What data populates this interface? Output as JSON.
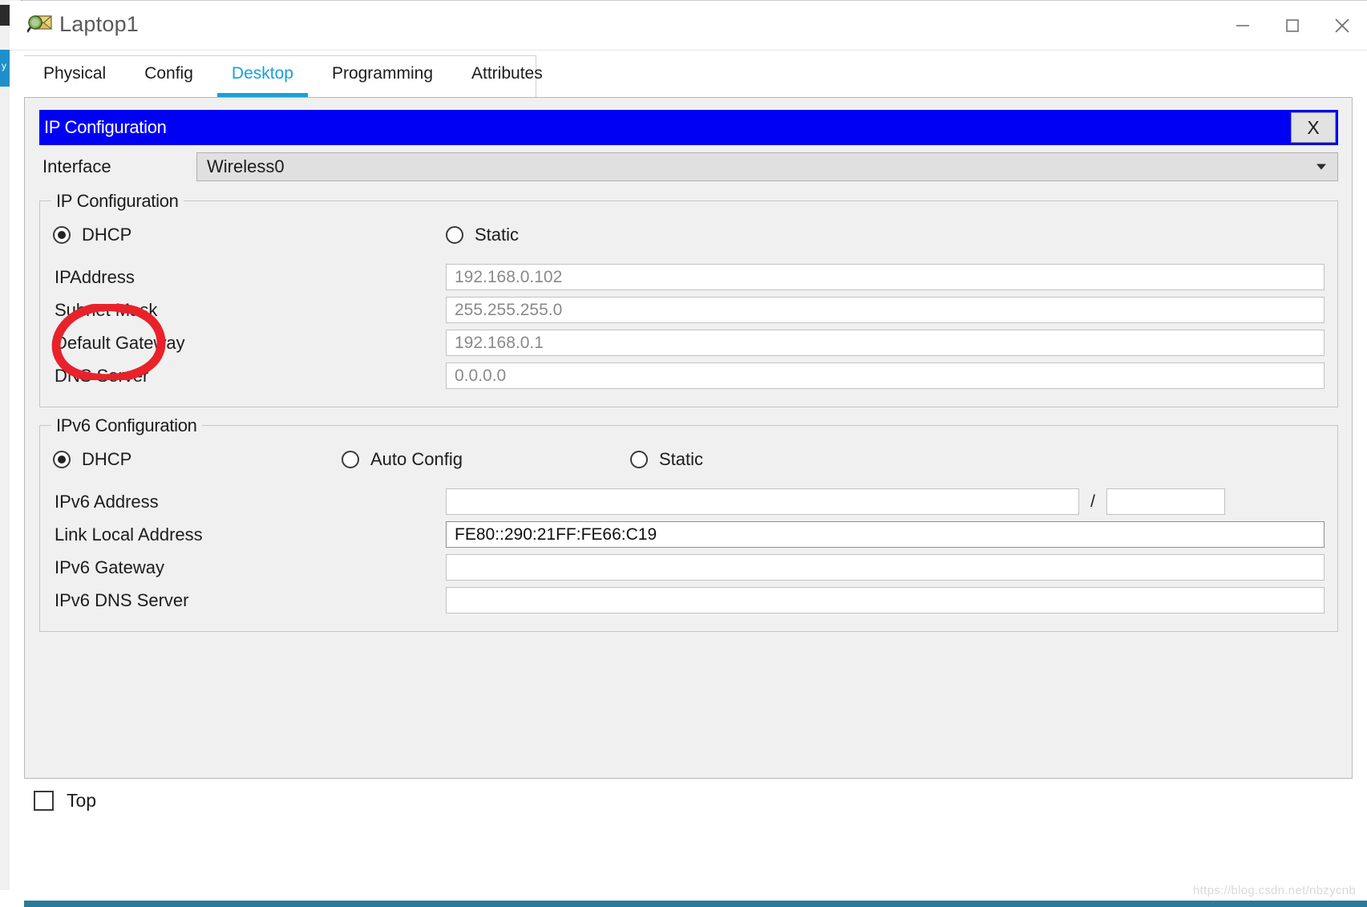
{
  "window": {
    "title": "Laptop1",
    "icon": "packet-tracer-magnifier-icon",
    "controls": {
      "minimize": "minimize-icon",
      "maximize": "maximize-icon",
      "close": "close-icon"
    }
  },
  "tabs": [
    {
      "label": "Physical",
      "active": false
    },
    {
      "label": "Config",
      "active": false
    },
    {
      "label": "Desktop",
      "active": true
    },
    {
      "label": "Programming",
      "active": false
    },
    {
      "label": "Attributes",
      "active": false
    }
  ],
  "dialog": {
    "header_title": "IP Configuration",
    "close_label": "X",
    "header_bg": "#0000f4"
  },
  "interface": {
    "label": "Interface",
    "value": "Wireless0",
    "options": [
      "Wireless0"
    ]
  },
  "ipv4": {
    "legend": "IP Configuration",
    "modes": [
      {
        "label": "DHCP",
        "selected": true
      },
      {
        "label": "Static",
        "selected": false
      }
    ],
    "fields": [
      {
        "label": "IPAddress",
        "value": "192.168.0.102",
        "editable": false
      },
      {
        "label": "Subnet Mask",
        "value": "255.255.255.0",
        "editable": false
      },
      {
        "label": "Default Gateway",
        "value": "192.168.0.1",
        "editable": false
      },
      {
        "label": "DNS Server",
        "value": "0.0.0.0",
        "editable": false
      }
    ]
  },
  "ipv6": {
    "legend": "IPv6 Configuration",
    "modes": [
      {
        "label": "DHCP",
        "selected": true
      },
      {
        "label": "Auto Config",
        "selected": false
      },
      {
        "label": "Static",
        "selected": false
      }
    ],
    "address": {
      "label": "IPv6 Address",
      "value": "",
      "separator": "/",
      "prefix_value": ""
    },
    "fields": [
      {
        "label": "Link Local Address",
        "value": "FE80::290:21FF:FE66:C19",
        "editable": true
      },
      {
        "label": "IPv6 Gateway",
        "value": "",
        "editable": false
      },
      {
        "label": "IPv6 DNS Server",
        "value": "",
        "editable": false
      }
    ]
  },
  "footer": {
    "top_checkbox_label": "Top",
    "top_checked": false
  },
  "annotation": {
    "type": "hand-drawn-red-circle",
    "color": "#e8222a",
    "targets": "ipv4-dhcp-radio"
  },
  "watermark": "https://blog.csdn.net/nbzycnb",
  "sidebar_fragment": {
    "label": "y"
  }
}
